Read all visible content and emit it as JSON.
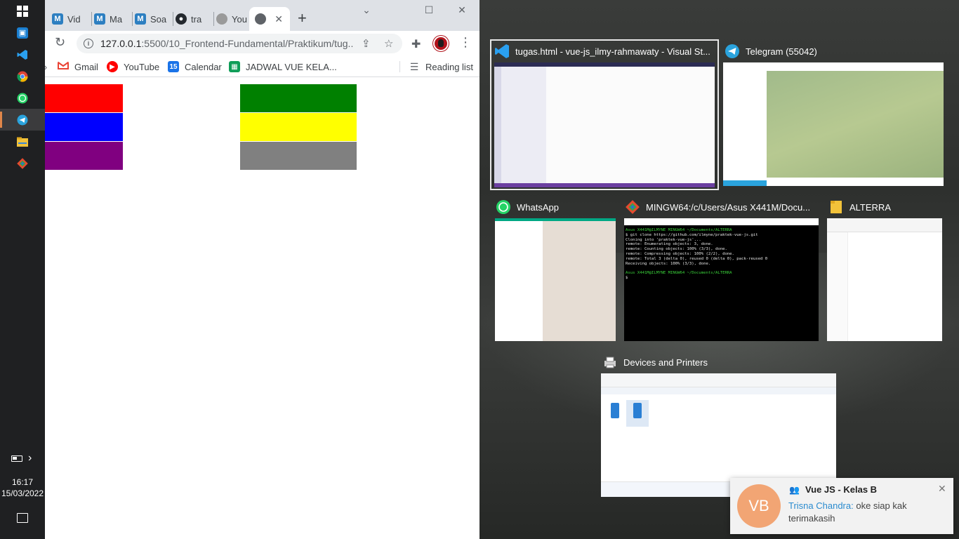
{
  "taskbar": {
    "time": "16:17",
    "date": "15/03/2022"
  },
  "browser": {
    "tabs": [
      {
        "label": "Vid",
        "icon": "m-icon",
        "color": "#2d7fc1"
      },
      {
        "label": "Ma",
        "icon": "m-icon",
        "color": "#2d7fc1"
      },
      {
        "label": "Soa",
        "icon": "m-icon",
        "color": "#2d7fc1"
      },
      {
        "label": "tra",
        "icon": "github-icon",
        "color": "#24292e"
      },
      {
        "label": "You",
        "icon": "globe-icon",
        "color": "#7b7b7b"
      },
      {
        "label": "",
        "icon": "globe-icon",
        "color": "#5f6368",
        "active": true
      }
    ],
    "url": {
      "host": "127.0.0.1",
      "rest": ":5500/10_Frontend-Fundamental/Praktikum/tug..."
    },
    "bookmarks": [
      {
        "label": "Gmail",
        "icon": "gmail-icon"
      },
      {
        "label": "YouTube",
        "icon": "youtube-icon"
      },
      {
        "label": "Calendar",
        "icon": "calendar-icon",
        "glyph": "15"
      },
      {
        "label": "JADWAL VUE KELA...",
        "icon": "sheets-icon"
      }
    ],
    "reading_list": "Reading list",
    "boxes": {
      "left": [
        "#ff0000",
        "#0000ff",
        "#800080"
      ],
      "right": [
        "#008000",
        "#ffff00",
        "#808080"
      ]
    }
  },
  "task_view": {
    "windows": [
      {
        "title": "tugas.html - vue-js_ilmy-rahmawaty - Visual St...",
        "app": "vscode"
      },
      {
        "title": "Telegram (55042)",
        "app": "telegram"
      },
      {
        "title": "WhatsApp",
        "app": "whatsapp"
      },
      {
        "title": "MINGW64:/c/Users/Asus X441M/Docu...",
        "app": "git-bash"
      },
      {
        "title": "ALTERRA",
        "app": "explorer"
      },
      {
        "title": "Devices and Printers",
        "app": "control-panel"
      }
    ],
    "terminal_lines": [
      {
        "text": "Asus X441M@ILMYNE MINGW64 ~/Documents/ALTERRA",
        "color": "#3ad13a"
      },
      {
        "text": "$ git clone https://github.com/ilmyne/praktek-vue-js.git",
        "color": "#e6e6e6"
      },
      {
        "text": "Cloning into 'praktek-vue-js'...",
        "color": "#e6e6e6"
      },
      {
        "text": "remote: Enumerating objects: 3, done.",
        "color": "#e6e6e6"
      },
      {
        "text": "remote: Counting objects: 100% (3/3), done.",
        "color": "#e6e6e6"
      },
      {
        "text": "remote: Compressing objects: 100% (2/2), done.",
        "color": "#e6e6e6"
      },
      {
        "text": "remote: Total 3 (delta 0), reused 0 (delta 0), pack-reused 0",
        "color": "#e6e6e6"
      },
      {
        "text": "Receiving objects: 100% (3/3), done.",
        "color": "#e6e6e6"
      },
      {
        "text": "",
        "color": "#e6e6e6"
      },
      {
        "text": "Asus X441M@ILMYNE MINGW64 ~/Documents/ALTERRA",
        "color": "#3ad13a"
      },
      {
        "text": "$",
        "color": "#e6e6e6"
      }
    ]
  },
  "notification": {
    "avatar": "VB",
    "title": "Vue JS - Kelas B",
    "sender": "Trisna Chandra:",
    "message": " oke siap kak terimakasih"
  }
}
